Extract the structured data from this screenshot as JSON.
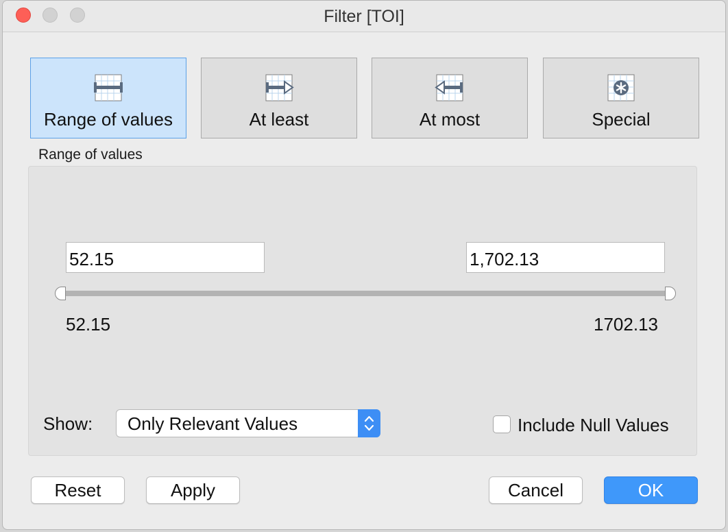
{
  "window": {
    "title": "Filter [TOI]"
  },
  "modes": [
    {
      "label": "Range of values",
      "icon": "range-icon",
      "selected": true
    },
    {
      "label": "At least",
      "icon": "at-least-icon",
      "selected": false
    },
    {
      "label": "At most",
      "icon": "at-most-icon",
      "selected": false
    },
    {
      "label": "Special",
      "icon": "special-icon",
      "selected": false
    }
  ],
  "range": {
    "section_label": "Range of values",
    "min_input": "52.15",
    "max_input": "1,702.13",
    "min_label": "52.15",
    "max_label": "1702.13",
    "min_value": 52.15,
    "max_value": 1702.13
  },
  "show": {
    "label": "Show:",
    "selected": "Only Relevant Values"
  },
  "include_null": {
    "label": "Include Null Values",
    "checked": false
  },
  "buttons": {
    "reset": "Reset",
    "apply": "Apply",
    "cancel": "Cancel",
    "ok": "OK"
  },
  "colors": {
    "accent": "#3f98fa",
    "selected_mode_bg": "#cce4fb",
    "close": "#fd5f57"
  }
}
